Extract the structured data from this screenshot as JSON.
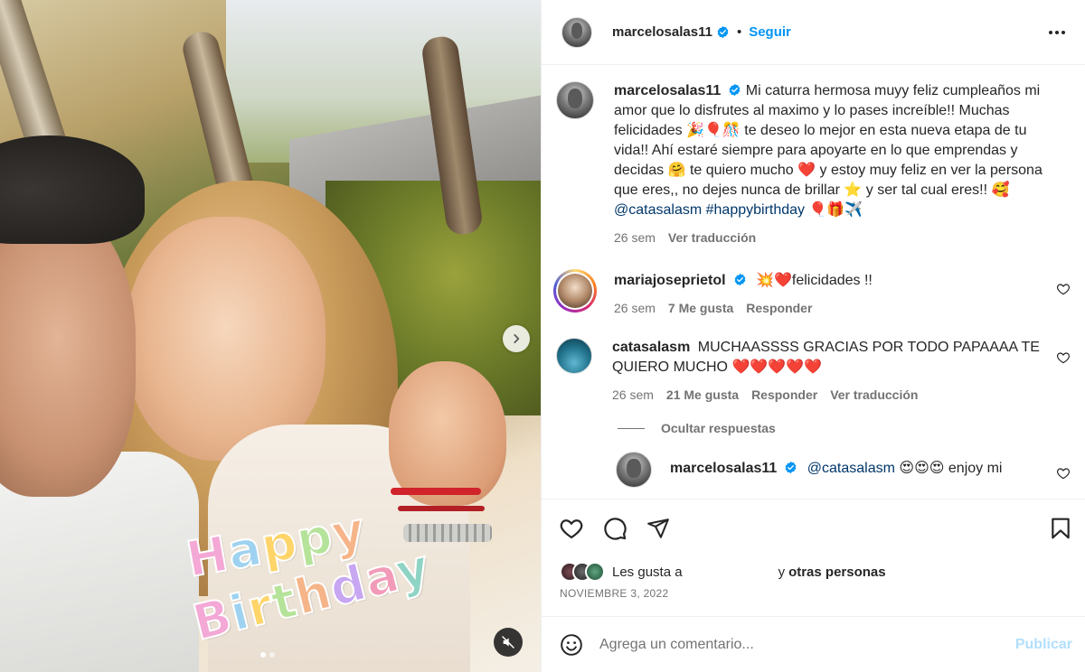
{
  "colors": {
    "accent": "#0095f6",
    "link": "#00376b",
    "muted": "#737373",
    "heart": "#ed4956",
    "publish_disabled": "#b2dffc"
  },
  "media": {
    "sticker_line1": "Happy",
    "sticker_line2": "Birthday",
    "carousel_total": 2,
    "carousel_active": 1,
    "icons": {
      "next": "chevron-right-icon",
      "mute": "speaker-muted-icon"
    }
  },
  "header": {
    "username": "marcelosalas11",
    "separator": "•",
    "follow_label": "Seguir",
    "more_icon": "more-options-icon"
  },
  "caption": {
    "username": "marcelosalas11",
    "text_1": "Mi caturra hermosa muyy feliz cumpleaños mi amor que lo disfrutes al maximo y lo pases increíble!! Muchas felicidades 🎉🎈🎊 te deseo lo mejor en esta nueva etapa de tu vida!! Ahí estaré siempre para apoyarte en lo que emprendas y decidas 🤗 te quiero mucho ❤️ y estoy muy feliz en ver la persona que eres,, no dejes nunca de brillar ⭐ y ser tal cual eres!! 🥰",
    "mention": "@catasalasm",
    "hashtag": "#happybirthday",
    "text_end": "🎈🎁✈️",
    "time": "26 sem",
    "translate": "Ver traducción"
  },
  "comments": [
    {
      "username": "mariajoseprietol",
      "text": "💥❤️felicidades !!",
      "time": "26 sem",
      "likes": "7 Me gusta",
      "reply": "Responder"
    },
    {
      "username": "catasalasm",
      "text": "MUCHAASSSS GRACIAS POR TODO PAPAAAA TE QUIERO MUCHO ❤️❤️❤️❤️❤️",
      "time": "26 sem",
      "likes": "21 Me gusta",
      "reply": "Responder",
      "translate": "Ver traducción"
    }
  ],
  "hide_replies": "Ocultar respuestas",
  "reply": {
    "username": "marcelosalas11",
    "mention": "@catasalasm",
    "text": "😍😍😍 enjoy mi"
  },
  "likes": {
    "prefix": "Les gusta a",
    "suffix": "y",
    "others": "otras personas"
  },
  "date": "NOVIEMBRE 3, 2022",
  "composer": {
    "placeholder": "Agrega un comentario...",
    "publish": "Publicar",
    "emoji_icon": "emoji-icon"
  }
}
